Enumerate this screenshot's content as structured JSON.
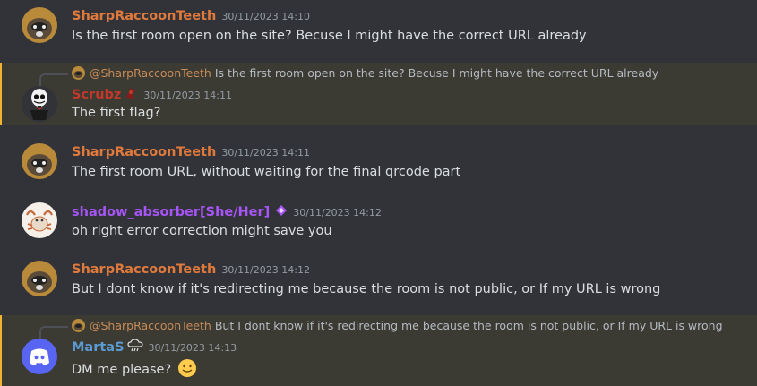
{
  "colors": {
    "raccoon": "#e07a3c",
    "scrubz": "#c0392b",
    "shadow": "#a855f7",
    "martas": "#5b9bd5"
  },
  "messages": [
    {
      "author": "SharpRaccoonTeeth",
      "time": "30/11/2023 14:10",
      "text": "Is the first room open on the site? Becuse I might have the correct URL already"
    },
    {
      "reply_author": "@SharpRaccoonTeeth",
      "reply_text": "Is the first room open on the site? Becuse I might have the correct URL already",
      "author": "Scrubz",
      "time": "30/11/2023 14:11",
      "text": "The first flag?"
    },
    {
      "author": "SharpRaccoonTeeth",
      "time": "30/11/2023 14:11",
      "text": "The first room URL, without waiting for the final qrcode part"
    },
    {
      "author": "shadow_absorber[She/Her]",
      "time": "30/11/2023 14:12",
      "text": "oh right error correction might save you"
    },
    {
      "author": "SharpRaccoonTeeth",
      "time": "30/11/2023 14:12",
      "text": "But I dont know if it's redirecting me because the room is not public, or  If my URL is wrong"
    },
    {
      "reply_author": "@SharpRaccoonTeeth",
      "reply_text": "But I dont know if it's redirecting me because the room is not public, or If my URL is wrong",
      "author": "MartaS",
      "time": "30/11/2023 14:13",
      "text": "DM me please?"
    }
  ],
  "icons": {
    "raccoon_avatar": "raccoon-avatar-icon",
    "skeleton_avatar": "skeleton-avatar-icon",
    "crab_avatar": "crab-avatar-icon",
    "discord_avatar": "discord-logo-icon",
    "guild_badge": "guild-tag-icon",
    "nitro_badge": "nitro-gem-icon",
    "cloud_badge": "rain-cloud-icon",
    "emoji": "slightly-smiling-face-emoji"
  }
}
